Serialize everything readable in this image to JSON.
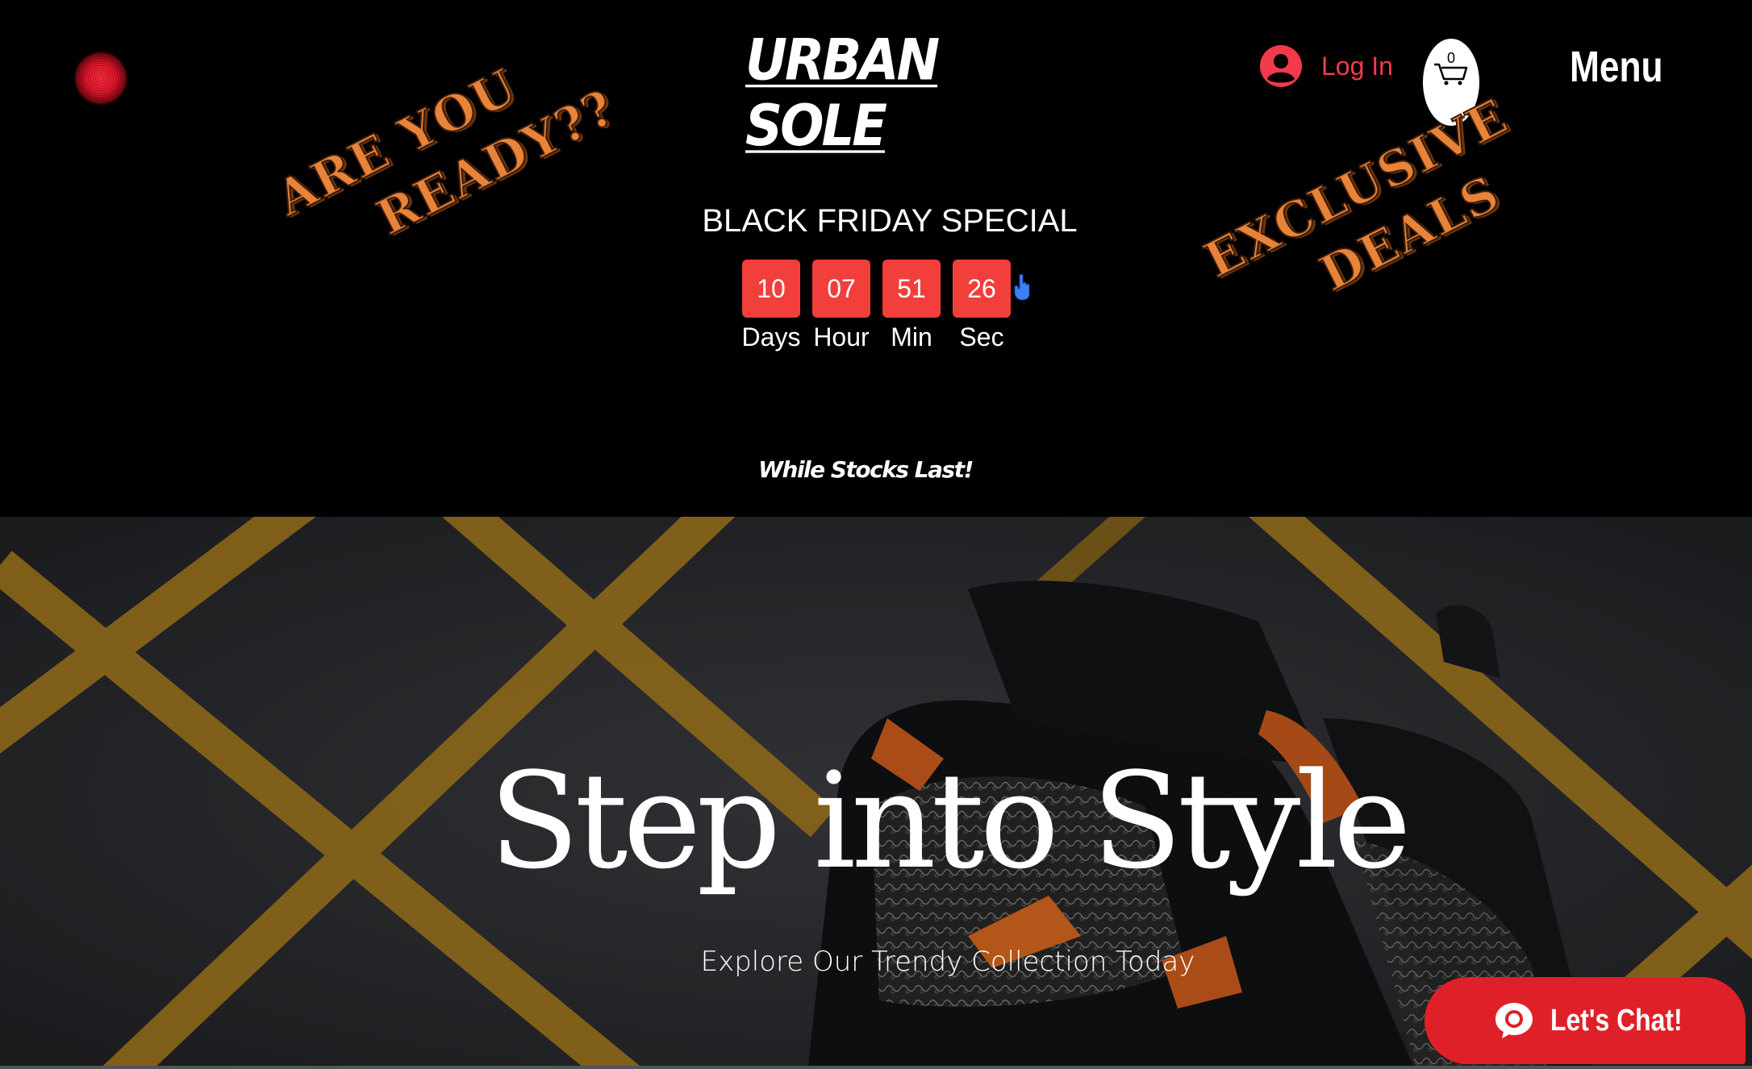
{
  "header": {
    "brand": "URBAN SOLE",
    "login_label": "Log In",
    "cart_count": "0",
    "menu_label": "Menu"
  },
  "promo": {
    "left_line1": "ARE YOU",
    "left_line2": "READY??",
    "right_line1": "EXCLUSIVE",
    "right_line2": "DEALS",
    "title": "BLACK FRIDAY SPECIAL",
    "countdown": [
      {
        "value": "10",
        "label": "Days"
      },
      {
        "value": "07",
        "label": "Hour"
      },
      {
        "value": "51",
        "label": "Min"
      },
      {
        "value": "26",
        "label": "Sec"
      }
    ],
    "tagline": "While Stocks Last!"
  },
  "hero": {
    "title": "Step into Style",
    "subtitle": "Explore Our Trendy Collection Today"
  },
  "chat": {
    "label": "Let's Chat!"
  },
  "colors": {
    "accent_red": "#f23f3b",
    "login_red": "#f23a4b",
    "promo_orange": "#e8833a",
    "chat_red": "#e02028"
  }
}
